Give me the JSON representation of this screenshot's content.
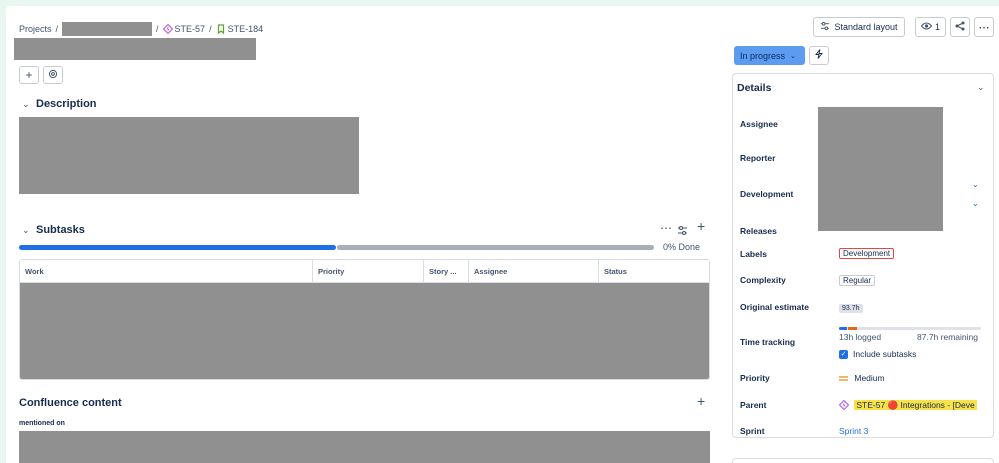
{
  "breadcrumbs": {
    "projects": "Projects",
    "sep": "/",
    "epic": "STE-57",
    "story": "STE-184"
  },
  "toolbar": {
    "layout_label": "Standard layout",
    "watchers_count": "1"
  },
  "status": {
    "label": "In progress"
  },
  "description": {
    "title": "Description"
  },
  "subtasks": {
    "title": "Subtasks",
    "progress_text": "0% Done",
    "progress_done": 0,
    "columns": [
      "Work",
      "Priority",
      "Story ...",
      "Assignee",
      "Status"
    ]
  },
  "confluence": {
    "title": "Confluence content",
    "mentioned_on": "mentioned on"
  },
  "details": {
    "title": "Details",
    "fields": {
      "assignee": "Assignee",
      "reporter": "Reporter",
      "development": "Development",
      "releases": "Releases",
      "labels": "Labels",
      "complexity": "Complexity",
      "original_estimate": "Original estimate",
      "time_tracking": "Time tracking",
      "priority": "Priority",
      "parent": "Parent",
      "sprint": "Sprint"
    },
    "values": {
      "labels": "Development",
      "complexity": "Regular",
      "original_estimate": "93.7h",
      "logged": "13h logged",
      "remaining": "87.7h remaining",
      "logged_fraction": 0.13,
      "include_subtasks": "Include subtasks",
      "priority": "Medium",
      "parent": "STE-57 🔴 Integrations - [Deve",
      "sprint": "Sprint 3"
    }
  },
  "colors": {
    "accent": "#1f6fe5",
    "status_bg": "#5b9cf0",
    "redaction": "#909090",
    "label_border": "#e2483d",
    "parent_highlight": "#f8e24a"
  },
  "icons": {
    "epic": "lightning-diamond-icon",
    "story": "bookmark-icon",
    "layout": "sliders-icon",
    "watch": "eye-icon",
    "share": "share-icon",
    "more": "more-icon",
    "add": "plus-icon",
    "apps": "apps-icon",
    "automation": "bolt-icon"
  }
}
